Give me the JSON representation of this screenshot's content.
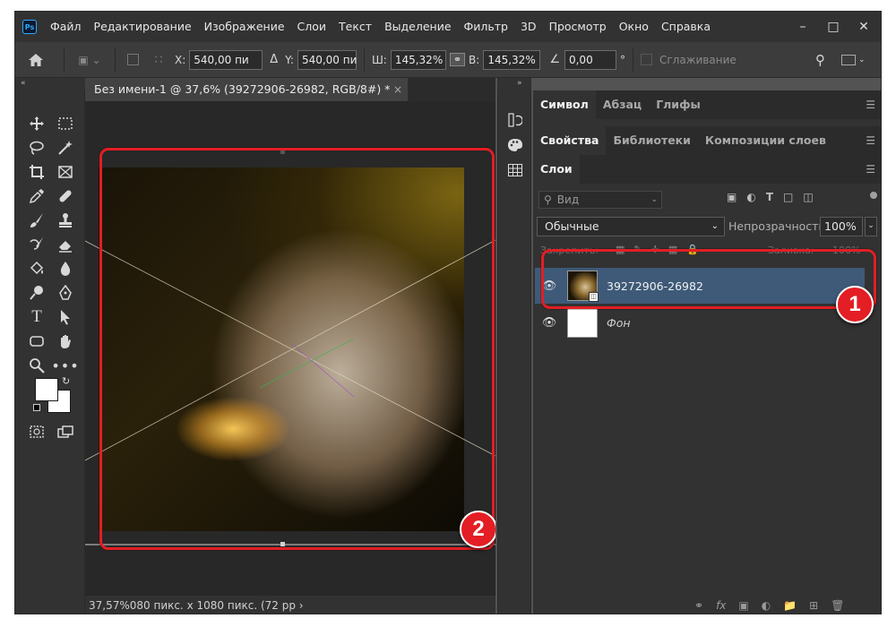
{
  "menu": {
    "app_icon": "Ps",
    "items": [
      "Файл",
      "Редактирование",
      "Изображение",
      "Слои",
      "Текст",
      "Выделение",
      "Фильтр",
      "3D",
      "Просмотр",
      "Окно",
      "Справка"
    ],
    "window_controls": [
      "minimize-icon",
      "maximize-icon",
      "close-icon"
    ]
  },
  "options": {
    "x_label": "X:",
    "x_value": "540,00 пи",
    "y_label": "Y:",
    "y_value": "540,00 пи",
    "w_label": "Ш:",
    "w_value": "145,32%",
    "h_label": "В:",
    "h_value": "145,32%",
    "angle_value": "0,00",
    "angle_unit": "°",
    "antialias_label": "Сглаживание"
  },
  "document": {
    "tab_title": "Без имени-1 @ 37,6% (39272906-26982, RGB/8#) *",
    "tab_close": "×",
    "status_zoom": "37,57%",
    "status_info": "080 пикс. x 1080 пикс. (72 pp ›"
  },
  "panels": {
    "top_tabs": [
      "Символ",
      "Абзац",
      "Глифы"
    ],
    "mid_tabs": [
      "Свойства",
      "Библиотеки",
      "Композиции слоев"
    ],
    "layers_tab": "Слои",
    "search_placeholder": "Вид",
    "blend_mode": "Обычные",
    "opacity_label": "Непрозрачность:",
    "opacity_value": "100%",
    "lock_label": "Закрепить:",
    "fill_label": "Заливка:",
    "fill_value": "100%"
  },
  "layers": [
    {
      "name": "39272906-26982",
      "selected": true
    },
    {
      "name": "Фон",
      "selected": false
    }
  ],
  "annotations": {
    "badge_1": "1",
    "badge_2": "2",
    "highlight_color": "#e31e24"
  }
}
